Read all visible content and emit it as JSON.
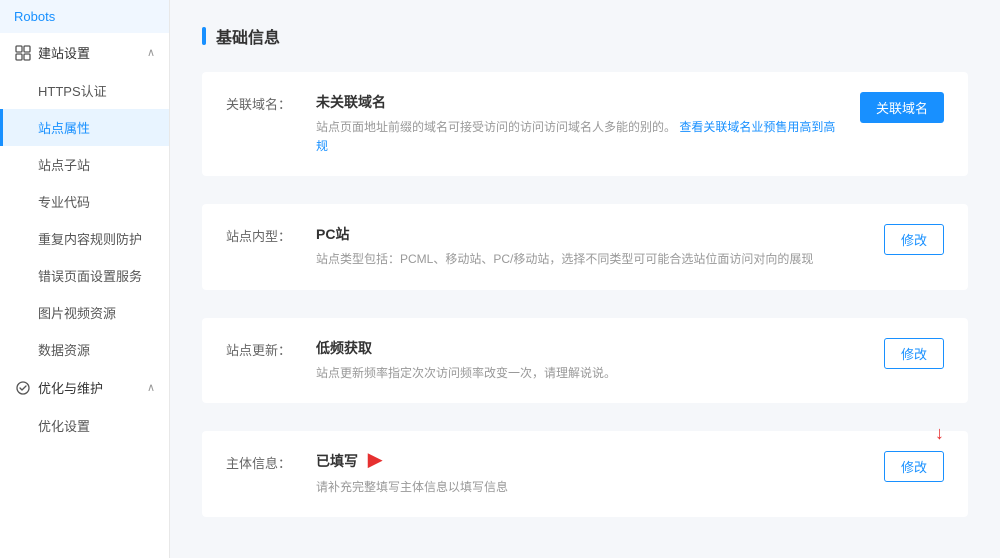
{
  "sidebar": {
    "groups": [
      {
        "id": "site-settings",
        "icon": "settings-icon",
        "label": "建站设置",
        "expanded": true,
        "items": [
          {
            "id": "https",
            "label": "HTTPS认证"
          },
          {
            "id": "site-props",
            "label": "站点属性",
            "active": true
          },
          {
            "id": "site-subdomain",
            "label": "站点子站"
          },
          {
            "id": "custom-code",
            "label": "专业代码"
          },
          {
            "id": "content-rules",
            "label": "重复内容规则防护"
          },
          {
            "id": "error-page",
            "label": "错误页面设置服务"
          },
          {
            "id": "media-resource",
            "label": "图片视频资源"
          },
          {
            "id": "data-resource",
            "label": "数据资源"
          }
        ]
      },
      {
        "id": "optimization",
        "icon": "optimize-icon",
        "label": "优化与维护",
        "expanded": true,
        "items": [
          {
            "id": "optimization-settings",
            "label": "优化设置"
          }
        ]
      }
    ],
    "top_items": [
      {
        "id": "robots",
        "label": "Robots"
      }
    ]
  },
  "main": {
    "section_title": "基础信息",
    "rows": [
      {
        "id": "related-domain",
        "label": "关联域名：",
        "title": "未关联域名",
        "desc": "站点页面地址前缀的域名可接受访问的访问访问域名人多能的别的。",
        "desc_link": "查看关联域名业预售用高到高规",
        "action_label": "关联域名",
        "action_type": "primary"
      },
      {
        "id": "pc-site",
        "label": "站点内型：",
        "title": "PC站",
        "desc": "站点类型包括：PCML、移动站、PC/移动站，选择不同类型可可能合选站位面访问对向的展现",
        "action_label": "修改",
        "action_type": "default"
      },
      {
        "id": "site-update",
        "label": "站点更新：",
        "title": "低频获取",
        "desc": "站点更新频率指定次次访问频率改变一次，请理解说说。",
        "action_label": "修改",
        "action_type": "default"
      },
      {
        "id": "already-set",
        "label": "主体信息：",
        "title": "已填写",
        "desc": "请补充完整填写主体信息以填写信息",
        "action_label": "修改",
        "action_type": "default",
        "has_arrow_left": true,
        "has_arrow_right": true
      }
    ]
  }
}
